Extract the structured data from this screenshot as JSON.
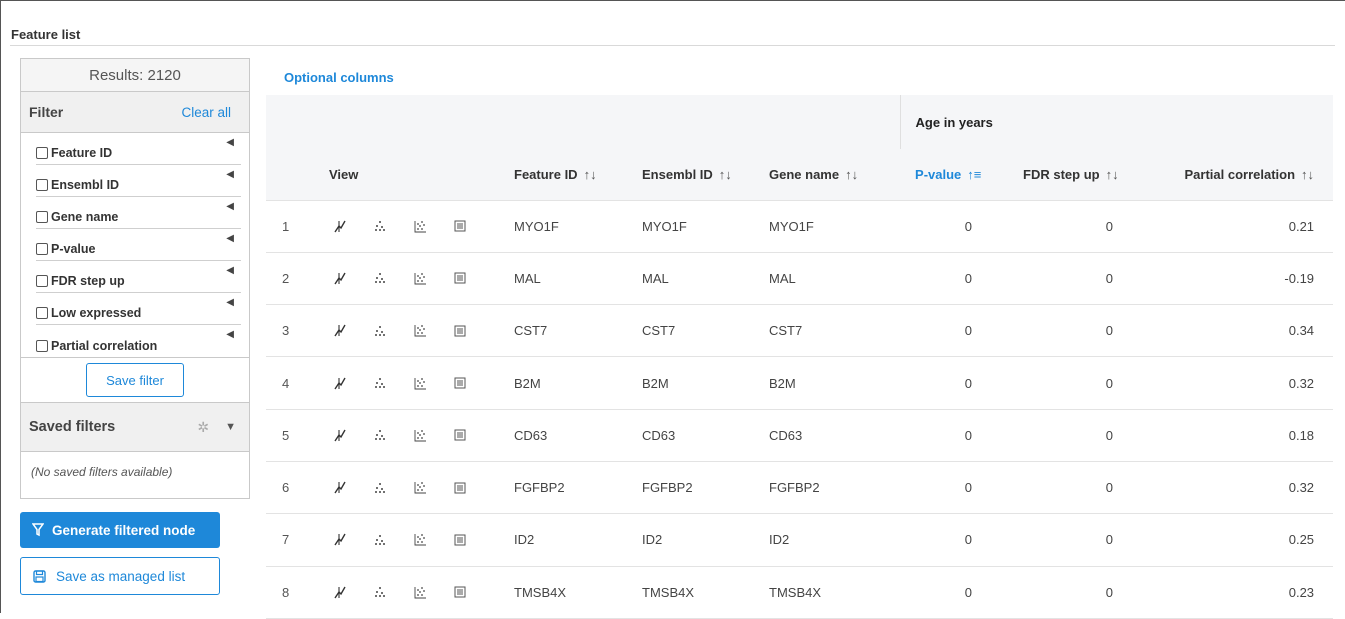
{
  "page": {
    "title": "Feature list"
  },
  "sidebar": {
    "results_label": "Results: 2120",
    "filter_title": "Filter",
    "clear_all": "Clear all",
    "filters": [
      {
        "label": "Feature ID"
      },
      {
        "label": "Ensembl ID"
      },
      {
        "label": "Gene name"
      },
      {
        "label": "P-value"
      },
      {
        "label": "FDR step up"
      },
      {
        "label": "Low expressed"
      },
      {
        "label": "Partial correlation"
      }
    ],
    "save_filter": "Save filter",
    "saved_filters_title": "Saved filters",
    "no_saved": "(No saved filters available)",
    "generate_button": "Generate filtered node",
    "managed_button": "Save as managed list"
  },
  "table": {
    "optional_columns": "Optional columns",
    "group_header": "Age in years",
    "columns": {
      "view": "View",
      "feature_id": "Feature ID",
      "ensembl_id": "Ensembl ID",
      "gene_name": "Gene name",
      "pvalue": "P-value",
      "fdr": "FDR step up",
      "partial": "Partial correlation"
    },
    "sort_glyph": "↑↓",
    "sort_active_glyph": "↑≡",
    "rows": [
      {
        "idx": "1",
        "feature_id": "MYO1F",
        "ensembl_id": "MYO1F",
        "gene_name": "MYO1F",
        "pvalue": "0",
        "fdr": "0",
        "partial": "0.21"
      },
      {
        "idx": "2",
        "feature_id": "MAL",
        "ensembl_id": "MAL",
        "gene_name": "MAL",
        "pvalue": "0",
        "fdr": "0",
        "partial": "-0.19"
      },
      {
        "idx": "3",
        "feature_id": "CST7",
        "ensembl_id": "CST7",
        "gene_name": "CST7",
        "pvalue": "0",
        "fdr": "0",
        "partial": "0.34"
      },
      {
        "idx": "4",
        "feature_id": "B2M",
        "ensembl_id": "B2M",
        "gene_name": "B2M",
        "pvalue": "0",
        "fdr": "0",
        "partial": "0.32"
      },
      {
        "idx": "5",
        "feature_id": "CD63",
        "ensembl_id": "CD63",
        "gene_name": "CD63",
        "pvalue": "0",
        "fdr": "0",
        "partial": "0.18"
      },
      {
        "idx": "6",
        "feature_id": "FGFBP2",
        "ensembl_id": "FGFBP2",
        "gene_name": "FGFBP2",
        "pvalue": "0",
        "fdr": "0",
        "partial": "0.32"
      },
      {
        "idx": "7",
        "feature_id": "ID2",
        "ensembl_id": "ID2",
        "gene_name": "ID2",
        "pvalue": "0",
        "fdr": "0",
        "partial": "0.25"
      },
      {
        "idx": "8",
        "feature_id": "TMSB4X",
        "ensembl_id": "TMSB4X",
        "gene_name": "TMSB4X",
        "pvalue": "0",
        "fdr": "0",
        "partial": "0.23"
      }
    ],
    "row_icons": [
      "dot-plot-icon",
      "scatter-plot-icon",
      "volcano-plot-icon",
      "details-list-icon"
    ]
  },
  "colors": {
    "accent": "#1e88d9",
    "header_bg": "#f5f6f8",
    "panel_bg": "#f0f0f0"
  }
}
